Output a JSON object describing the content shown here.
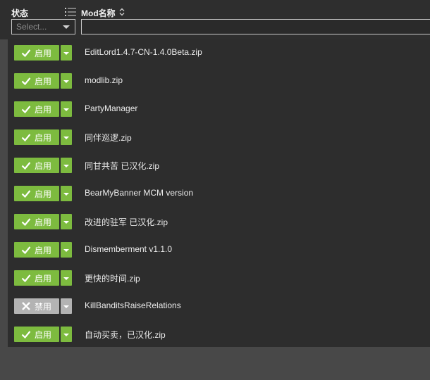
{
  "header": {
    "status_label": "状态",
    "mod_label": "Mod名称",
    "status_filter_placeholder": "Select...",
    "mod_filter_value": ""
  },
  "icons": {
    "list": "list-icon",
    "sort": "sort-icon",
    "enabled": "check-icon",
    "disabled": "x-icon"
  },
  "colors": {
    "enabled": "#7dbb3f",
    "disabled": "#b3b3b3",
    "panel": "#2d2d2d",
    "background": "#484848"
  },
  "mods": [
    {
      "status": "启用",
      "enabled": true,
      "name": "EditLord1.4.7-CN-1.4.0Beta.zip"
    },
    {
      "status": "启用",
      "enabled": true,
      "name": "modlib.zip"
    },
    {
      "status": "启用",
      "enabled": true,
      "name": "PartyManager"
    },
    {
      "status": "启用",
      "enabled": true,
      "name": "同伴巡逻.zip"
    },
    {
      "status": "启用",
      "enabled": true,
      "name": "同甘共苦 已汉化.zip"
    },
    {
      "status": "启用",
      "enabled": true,
      "name": "BearMyBanner MCM version"
    },
    {
      "status": "启用",
      "enabled": true,
      "name": "改进的驻军 已汉化.zip"
    },
    {
      "status": "启用",
      "enabled": true,
      "name": "Dismemberment v1.1.0"
    },
    {
      "status": "启用",
      "enabled": true,
      "name": "更快的时间.zip"
    },
    {
      "status": "禁用",
      "enabled": false,
      "name": "KillBanditsRaiseRelations"
    },
    {
      "status": "启用",
      "enabled": true,
      "name": "自动买卖，已汉化.zip"
    }
  ]
}
